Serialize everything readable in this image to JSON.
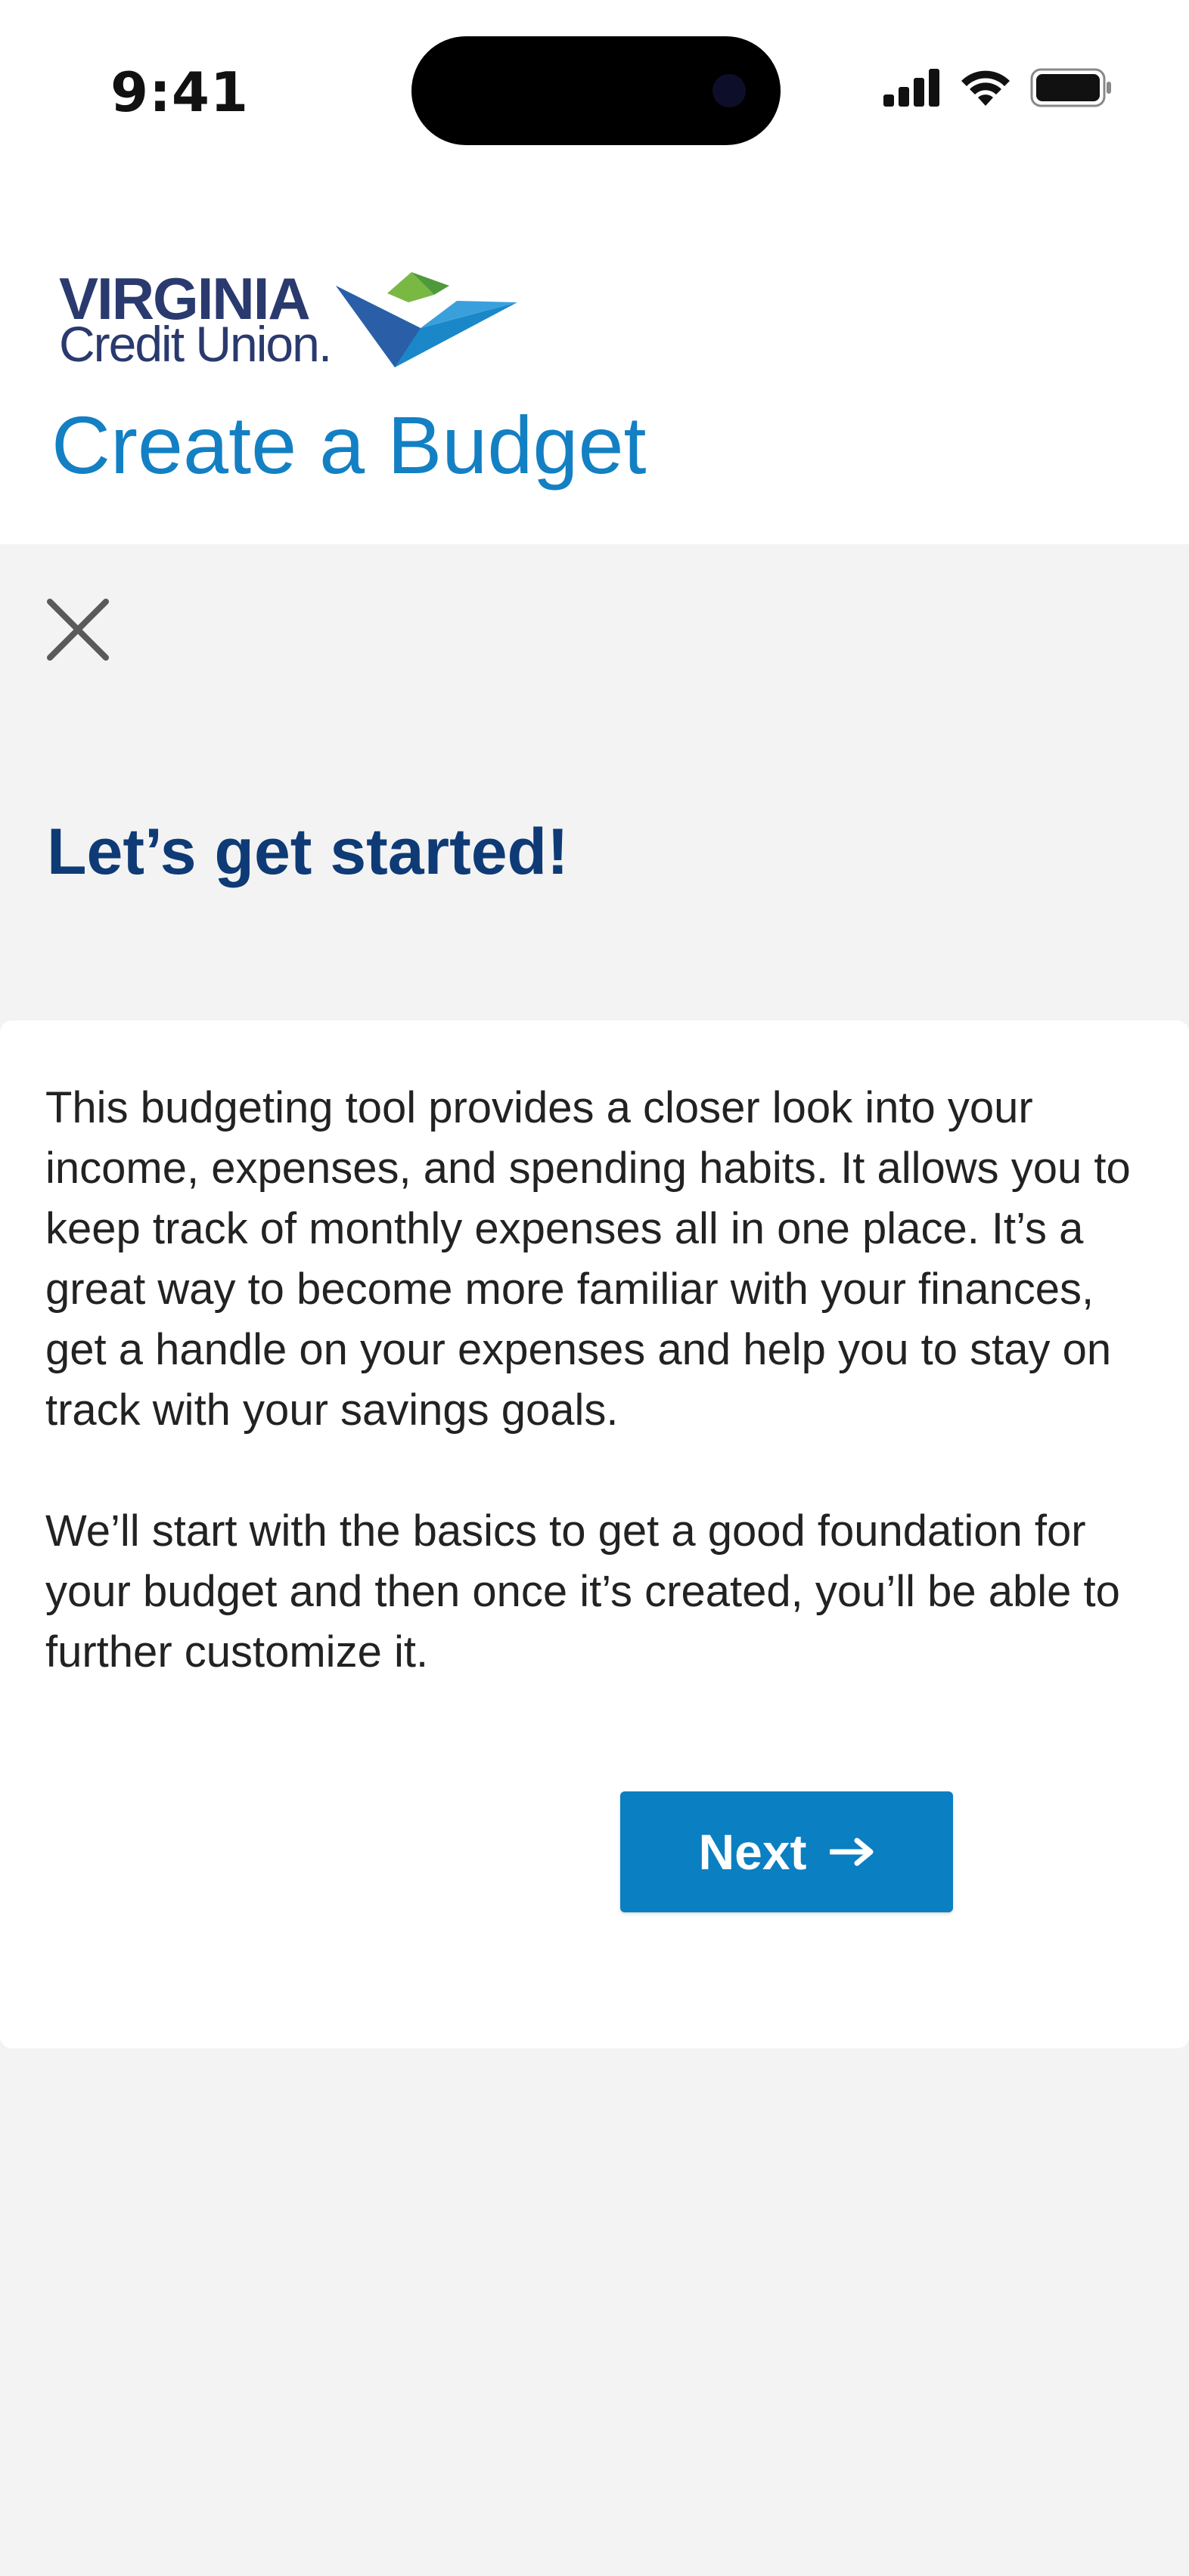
{
  "status_bar": {
    "time": "9:41",
    "icons": [
      "cellular-signal-icon",
      "wifi-icon",
      "battery-icon"
    ]
  },
  "header": {
    "logo": {
      "line1": "VIRGINIA",
      "line2": "Credit Union."
    },
    "title": "Create a Budget"
  },
  "main": {
    "close_icon": "close-icon",
    "headline": "Let’s get started!",
    "card": {
      "paragraph_1": "This budgeting tool provides a closer look into your income, expenses, and spending habits. It allows you to keep track of monthly expenses all in one place. It’s a great way to become more familiar with your finances, get a handle on your expenses and help you to stay on track with your savings goals.",
      "paragraph_2": "We’ll start with the basics to get a good foundation for your budget and then once it’s created, you’ll be able to further customize it.",
      "next_button": {
        "label": "Next",
        "icon": "arrow-right-icon"
      }
    }
  },
  "colors": {
    "brand_blue": "#1380c4",
    "brand_navy": "#0e3b76",
    "button_blue": "#0a7fc2",
    "page_background": "#f3f3f3",
    "card_background": "#ffffff"
  }
}
